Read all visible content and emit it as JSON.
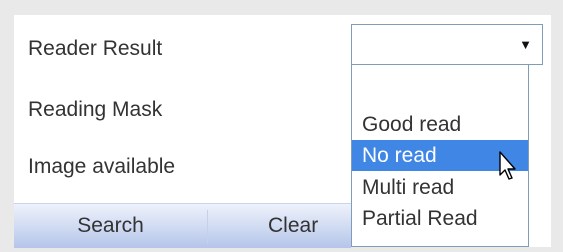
{
  "form": {
    "reader_result_label": "Reader Result",
    "reading_mask_label": "Reading Mask",
    "image_available_label": "Image available"
  },
  "dropdown": {
    "selected_value": "",
    "arrow_icon": "▼",
    "options": [
      "Good read",
      "No read",
      "Multi read",
      "Partial Read"
    ],
    "highlighted_option": "No read"
  },
  "buttons": {
    "search_label": "Search",
    "clear_label": "Clear"
  },
  "colors": {
    "highlight": "#3f86e5",
    "border": "#7f9db9",
    "button_gradient_top": "#eef2fb",
    "button_gradient_bottom": "#b5c5ea"
  },
  "icons": {
    "cursor": "mouse-pointer-icon"
  }
}
